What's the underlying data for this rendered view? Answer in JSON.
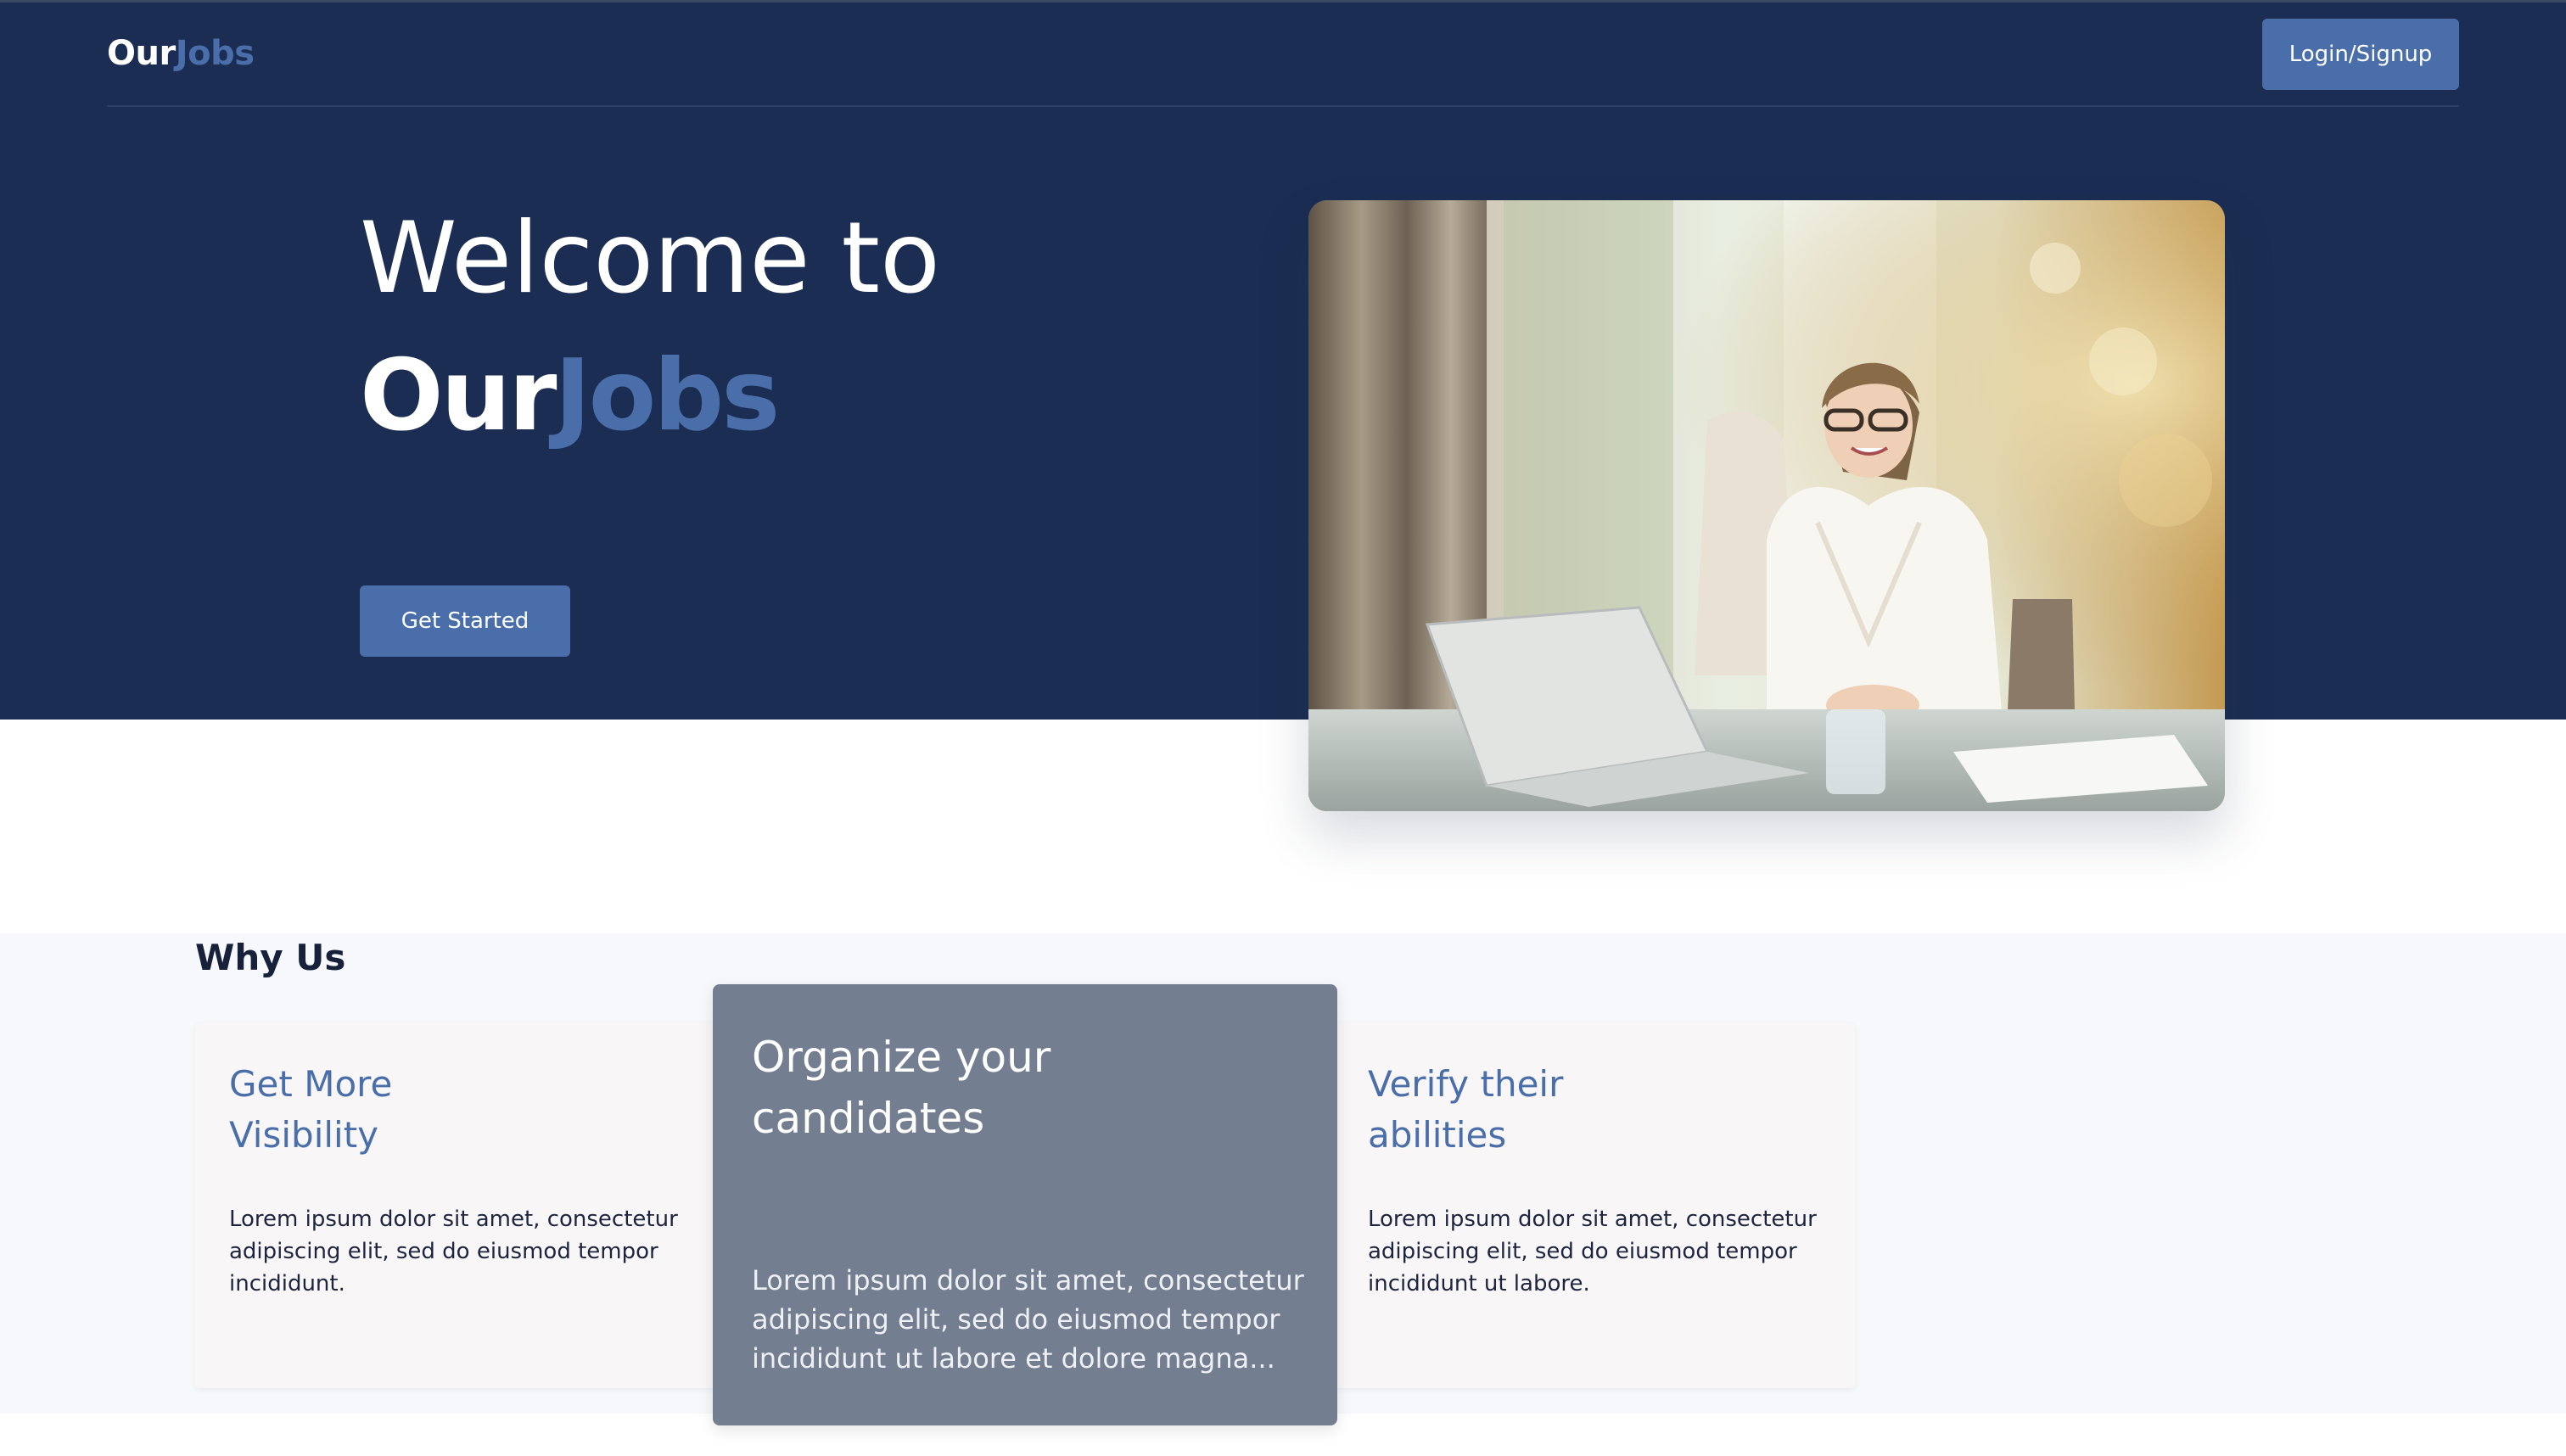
{
  "navbar": {
    "logo_part1": "Our",
    "logo_part2": "Jobs",
    "login_label": "Login/Signup"
  },
  "hero": {
    "title_line1": "Welcome to",
    "title_part1": "Our",
    "title_part2": "Jobs",
    "cta_label": "Get Started",
    "image": "smiling-woman-at-laptop-photo"
  },
  "why_us": {
    "title": "Why Us",
    "cards": [
      {
        "title": "Get More Visibility",
        "body": "Lorem ipsum dolor sit amet, consectetur adipiscing elit, sed do eiusmod tempor incididunt."
      },
      {
        "title": "Organize your candidates",
        "body": "Lorem ipsum dolor sit amet, consectetur adipiscing elit, sed do eiusmod tempor incididunt ut labore et dolore magna..."
      },
      {
        "title": "Verify their abilities",
        "body": "Lorem ipsum dolor sit amet, consectetur adipiscing elit, sed do eiusmod tempor incididunt ut labore."
      }
    ]
  },
  "colors": {
    "navy": "#1b2d52",
    "accent": "#4a6eaa",
    "highlight_card": "#737e91",
    "section_bg": "#f7f8fb"
  }
}
